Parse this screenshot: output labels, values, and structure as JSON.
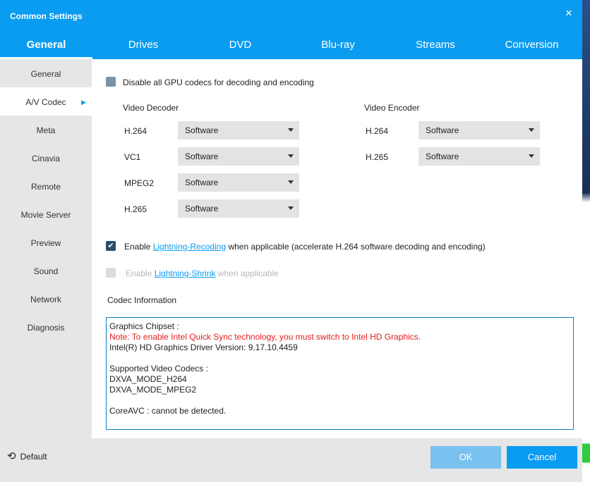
{
  "window": {
    "title": "Common Settings"
  },
  "tabs": [
    {
      "label": "General"
    },
    {
      "label": "Drives"
    },
    {
      "label": "DVD"
    },
    {
      "label": "Blu-ray"
    },
    {
      "label": "Streams"
    },
    {
      "label": "Conversion"
    }
  ],
  "sidebar": {
    "items": [
      {
        "label": "General"
      },
      {
        "label": "A/V Codec"
      },
      {
        "label": "Meta"
      },
      {
        "label": "Cinavia"
      },
      {
        "label": "Remote"
      },
      {
        "label": "Movie Server"
      },
      {
        "label": "Preview"
      },
      {
        "label": "Sound"
      },
      {
        "label": "Network"
      },
      {
        "label": "Diagnosis"
      }
    ]
  },
  "codec": {
    "disable_gpu_label": "Disable all GPU codecs for decoding and encoding",
    "decoder_heading": "Video Decoder",
    "encoder_heading": "Video Encoder",
    "decoders": [
      {
        "name": "H.264",
        "value": "Software"
      },
      {
        "name": "VC1",
        "value": "Software"
      },
      {
        "name": "MPEG2",
        "value": "Software"
      },
      {
        "name": "H.265",
        "value": "Software"
      }
    ],
    "encoders": [
      {
        "name": "H.264",
        "value": "Software"
      },
      {
        "name": "H.265",
        "value": "Software"
      }
    ],
    "lightning_recoding": {
      "prefix": "Enable ",
      "link": "Lightning-Recoding",
      "suffix": " when applicable (accelerate H.264 software decoding and encoding)",
      "checked": true
    },
    "lightning_shrink": {
      "prefix": "Enable ",
      "link": "Lightning-Shrink",
      "suffix": " when applicable",
      "enabled": false
    },
    "info_heading": "Codec Information",
    "info": {
      "chipset": "Graphics Chipset :",
      "note": "Note: To enable Intel Quick Sync technology, you must switch to Intel HD Graphics.",
      "driver": "Intel(R) HD Graphics Driver Version: 9.17.10.4459",
      "supported_heading": "Supported Video Codecs :",
      "supported": [
        "DXVA_MODE_H264",
        "DXVA_MODE_MPEG2"
      ],
      "coreavc": "CoreAVC : cannot be detected."
    }
  },
  "footer": {
    "default_label": "Default",
    "ok_label": "OK",
    "cancel_label": "Cancel"
  },
  "colors": {
    "accent": "#0a9cf0",
    "ok_disabled": "#79c2f0",
    "note_red": "#e0201e"
  }
}
